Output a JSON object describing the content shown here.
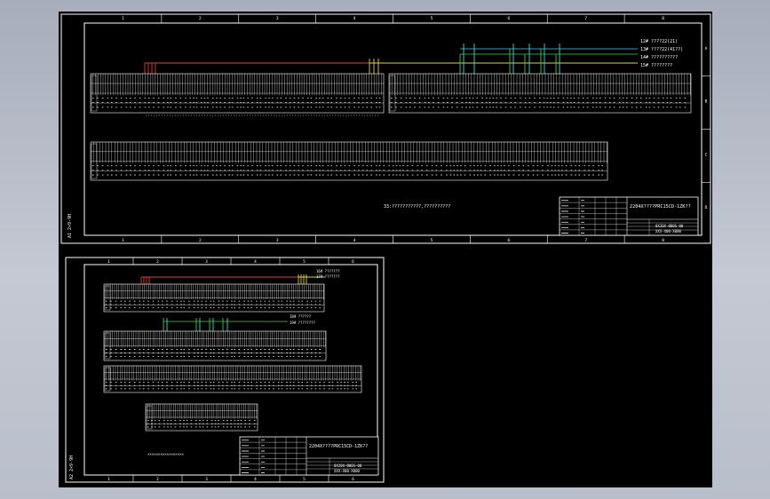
{
  "colors": {
    "desktop": "#b4bac6",
    "drawing_bg": "#000000",
    "frame": "#ffffff",
    "wire_red": "#e23b3b",
    "wire_yellow": "#e6d23a",
    "wire_green": "#3fcf3f",
    "wire_cyan": "#3ad8e0"
  },
  "sheet1": {
    "zone_numbers": [
      "1",
      "2",
      "3",
      "4",
      "5",
      "6",
      "7",
      "8"
    ],
    "zone_letters": [
      "A",
      "B",
      "C",
      "D"
    ],
    "side_label": "A1 2×9-9H",
    "legend": [
      {
        "tag": "12#",
        "text": "????22(21)"
      },
      {
        "tag": "13#",
        "text": "????22(41??)"
      },
      {
        "tag": "14#",
        "text": "??????????"
      },
      {
        "tag": "15#",
        "text": "????????"
      }
    ],
    "center_note": "33:???????????,??????????",
    "title_block": {
      "title": "2204X????PRC15CD-1ZK??",
      "drawing_no": "8X20X-B00S-00",
      "sub_no": "XXX-X00-X000"
    }
  },
  "sheet2": {
    "zone_numbers": [
      "1",
      "2",
      "3",
      "4",
      "5",
      "6"
    ],
    "side_label": "A2 2×9-9H",
    "legend_top": [
      {
        "tag": "16#",
        "text": "???????"
      },
      {
        "tag": "17#",
        "text": "???????"
      }
    ],
    "legend_mid": [
      {
        "tag": "18#",
        "text": "??????"
      },
      {
        "tag": "19#",
        "text": "????????"
      }
    ],
    "bottom_note": "×××××××××××××××××",
    "title_block": {
      "title": "2204X????PRC15CD-1ZK??",
      "drawing_no": "8X20X-B00S-00",
      "sub_no": "XXX-X00-X000"
    }
  }
}
